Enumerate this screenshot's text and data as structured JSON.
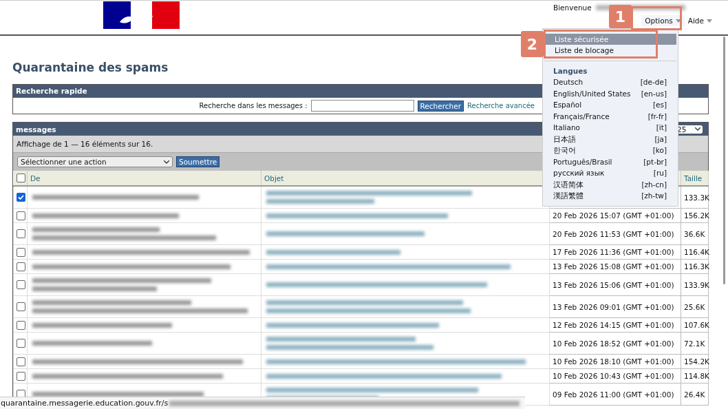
{
  "header": {
    "welcome": "Bienvenue",
    "menus": [
      {
        "label": "Options",
        "open": true
      },
      {
        "label": "Aide",
        "open": false
      }
    ]
  },
  "options_menu": {
    "items": [
      {
        "label": "Liste sécurisée",
        "selected": true
      },
      {
        "label": "Liste de blocage",
        "selected": false
      }
    ],
    "languages_title": "Langues",
    "languages": [
      {
        "name": "Deutsch",
        "code": "[de-de]"
      },
      {
        "name": "English/United States",
        "code": "[en-us]"
      },
      {
        "name": "Español",
        "code": "[es]"
      },
      {
        "name": "Français/France",
        "code": "[fr-fr]"
      },
      {
        "name": "Italiano",
        "code": "[it]"
      },
      {
        "name": "日本語",
        "code": "[ja]"
      },
      {
        "name": "한국어",
        "code": "[ko]"
      },
      {
        "name": "Português/Brasil",
        "code": "[pt-br]"
      },
      {
        "name": "русский язык",
        "code": "[ru]"
      },
      {
        "name": "汉语简体",
        "code": "[zh-cn]"
      },
      {
        "name": "漢語繁體",
        "code": "[zh-tw]"
      }
    ]
  },
  "callouts": [
    {
      "number": "1"
    },
    {
      "number": "2"
    }
  ],
  "page_title": "Quarantaine des spams",
  "quick_search": {
    "title": "Recherche rapide",
    "label": "Recherche dans les messages :",
    "button": "Rechercher",
    "advanced_link": "Recherche avancée"
  },
  "messages": {
    "title": "messages",
    "page_size": "25",
    "summary": "Affichage de 1 — 16 éléments sur 16.",
    "action_select": "Sélectionner une action",
    "submit": "Soumettre",
    "columns": [
      "De",
      "Objet",
      "Taille"
    ],
    "select_all_checked": false,
    "rows": [
      {
        "checked": true,
        "from_wrapped": false,
        "subject_wrapped": true,
        "size": "133.3K"
      },
      {
        "checked": false,
        "from_wrapped": false,
        "subject_wrapped": false,
        "date": "20 Feb 2026 15:07 (GMT +01:00)",
        "size": "156.2K"
      },
      {
        "checked": false,
        "from_wrapped": true,
        "subject_wrapped": false,
        "date": "20 Feb 2026 11:53 (GMT +01:00)",
        "size": "36.6K"
      },
      {
        "checked": false,
        "from_wrapped": false,
        "subject_wrapped": false,
        "date": "17 Feb 2026 11:36 (GMT +01:00)",
        "size": "116.4K"
      },
      {
        "checked": false,
        "from_wrapped": false,
        "subject_wrapped": false,
        "date": "13 Feb 2026 15:08 (GMT +01:00)",
        "size": "116.3K"
      },
      {
        "checked": false,
        "from_wrapped": true,
        "subject_wrapped": false,
        "date": "13 Feb 2026 15:06 (GMT +01:00)",
        "size": "133.9K"
      },
      {
        "checked": false,
        "from_wrapped": true,
        "subject_wrapped": true,
        "date": "13 Feb 2026 09:01 (GMT +01:00)",
        "size": "25.6K"
      },
      {
        "checked": false,
        "from_wrapped": false,
        "subject_wrapped": false,
        "date": "12 Feb 2026 14:15 (GMT +01:00)",
        "size": "107.6K"
      },
      {
        "checked": false,
        "from_wrapped": false,
        "subject_wrapped": true,
        "date": "10 Feb 2026 18:52 (GMT +01:00)",
        "size": "72.1K"
      },
      {
        "checked": false,
        "from_wrapped": false,
        "subject_wrapped": false,
        "date": "10 Feb 2026 18:10 (GMT +01:00)",
        "size": "154.2K"
      },
      {
        "checked": false,
        "from_wrapped": false,
        "subject_wrapped": false,
        "date": "10 Feb 2026 10:43 (GMT +01:00)",
        "size": "114.8K"
      },
      {
        "checked": false,
        "from_wrapped": false,
        "subject_wrapped": true,
        "date": "09 Feb 2026 11:00 (GMT +01:00)",
        "size": "26.4K"
      }
    ]
  },
  "status_bar": {
    "url": "quarantaine.messagerie.education.gouv.fr/s"
  }
}
